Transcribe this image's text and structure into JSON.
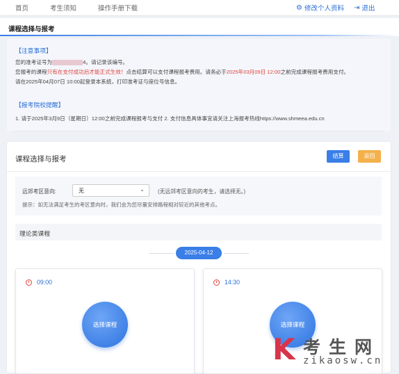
{
  "nav": {
    "items": [
      "首页",
      "考生须知",
      "操作手册下载"
    ],
    "profile": "修改个人资料",
    "logout": "退出"
  },
  "page_title": "课程选择与报考",
  "notice": {
    "title1": "【注意事项】",
    "line1_a": "您的准考证号为",
    "line1_b": "4。请记录该编号。",
    "line2_a": "您报考的课程",
    "line2_red1": "只有在支付成功后才能正式生效！",
    "line2_b": "点击结算可以支付课程报考费用。请务必于",
    "line2_red2": "2025年03月09日 12:00",
    "line2_c": "之前完成课程报考费用支付。",
    "line3": "请在2025年04月07日 10:00起登录本系统，打印准考证与座位号信息。",
    "title2": "【报考院校提醒】",
    "line4": "1. 请于2025年3月9日（星期日）12:00之前完成课程报考与支付 2. 支付信息具体事宜请关注上海报考热线https://www.shmeea.edu.cn"
  },
  "card": {
    "title": "课程选择与报考",
    "btn_calc": "结算",
    "btn_back": "返回"
  },
  "filter": {
    "label": "远郊考区意向:",
    "select_value": "无",
    "hint": "(无远郊考区意向的考生，请选择无。)",
    "tip": "提示：如无法满足考生的考区意向时，我们会为您尽量安排路程相对较近的其他考点。"
  },
  "subhead": "理论类课程",
  "date": "2025-04-12",
  "slots": [
    {
      "time": "09:00",
      "button": "选择课程"
    },
    {
      "time": "14:30",
      "button": "选择课程"
    }
  ],
  "watermark": {
    "k": "K",
    "cn": "考生网",
    "en": "zikaosw.cn"
  },
  "colors": {
    "primary": "#3a7ee8",
    "warning": "#f4b04a",
    "danger": "#e0403a"
  },
  "icons": {
    "profile": "gear-icon",
    "logout": "logout-icon",
    "clock": "alarm-clock-icon"
  }
}
